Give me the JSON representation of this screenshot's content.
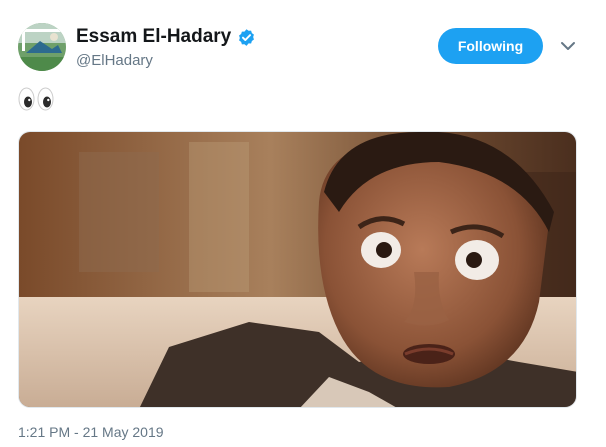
{
  "tweet": {
    "display_name": "Essam El-Hadary",
    "handle": "@ElHadary",
    "verified": true,
    "follow_button_label": "Following",
    "body_emoji": "👀",
    "timestamp": "1:21 PM - 21 May 2019"
  },
  "icons": {
    "verified": "verified-badge-icon",
    "menu": "chevron-down-icon",
    "emoji": "eyes-emoji-icon"
  },
  "colors": {
    "accent": "#1da1f2",
    "name_text": "#14171a",
    "secondary_text": "#657786"
  }
}
